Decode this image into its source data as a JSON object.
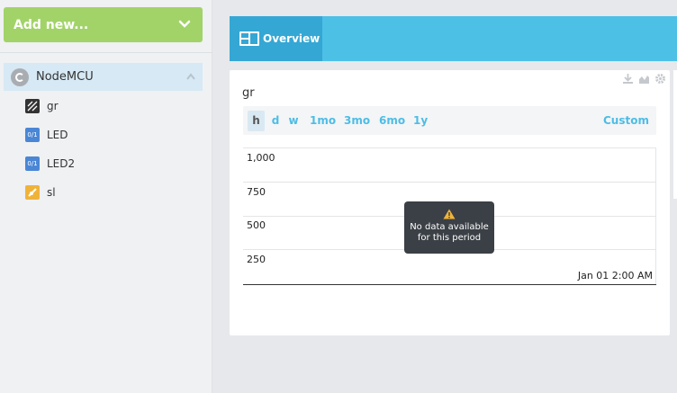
{
  "sidebar": {
    "add_new_label": "Add new...",
    "device": {
      "name": "NodeMCU",
      "icon": "device-icon"
    },
    "widgets": [
      {
        "label": "gr",
        "icon": "graph-icon"
      },
      {
        "label": "LED",
        "icon": "led-toggle-icon",
        "icon_text": "0/1"
      },
      {
        "label": "LED2",
        "icon": "led-toggle-icon",
        "icon_text": "0/1"
      },
      {
        "label": "sl",
        "icon": "slider-icon"
      }
    ]
  },
  "tabs": [
    {
      "label": "Overview",
      "icon": "dashboard-icon"
    }
  ],
  "card": {
    "title": "gr",
    "tools": [
      "download-icon",
      "chart-icon",
      "gear-icon"
    ],
    "ranges": [
      "h",
      "d",
      "w",
      "1mo",
      "3mo",
      "6mo",
      "1y"
    ],
    "custom_label": "Custom",
    "active_range": "h"
  },
  "chart_data": {
    "type": "line",
    "title": "gr",
    "y_ticks": [
      "1,000",
      "750",
      "500",
      "250"
    ],
    "x_ticks": [
      "Jan 01 2:00 AM"
    ],
    "series": [],
    "ylim": [
      0,
      1000
    ],
    "message": "No data available for this period"
  },
  "colors": {
    "add_new": "#a2d368",
    "tab_bar": "#4dc0e6",
    "tab_active": "#35a7d4",
    "range_text": "#4dbde6"
  }
}
